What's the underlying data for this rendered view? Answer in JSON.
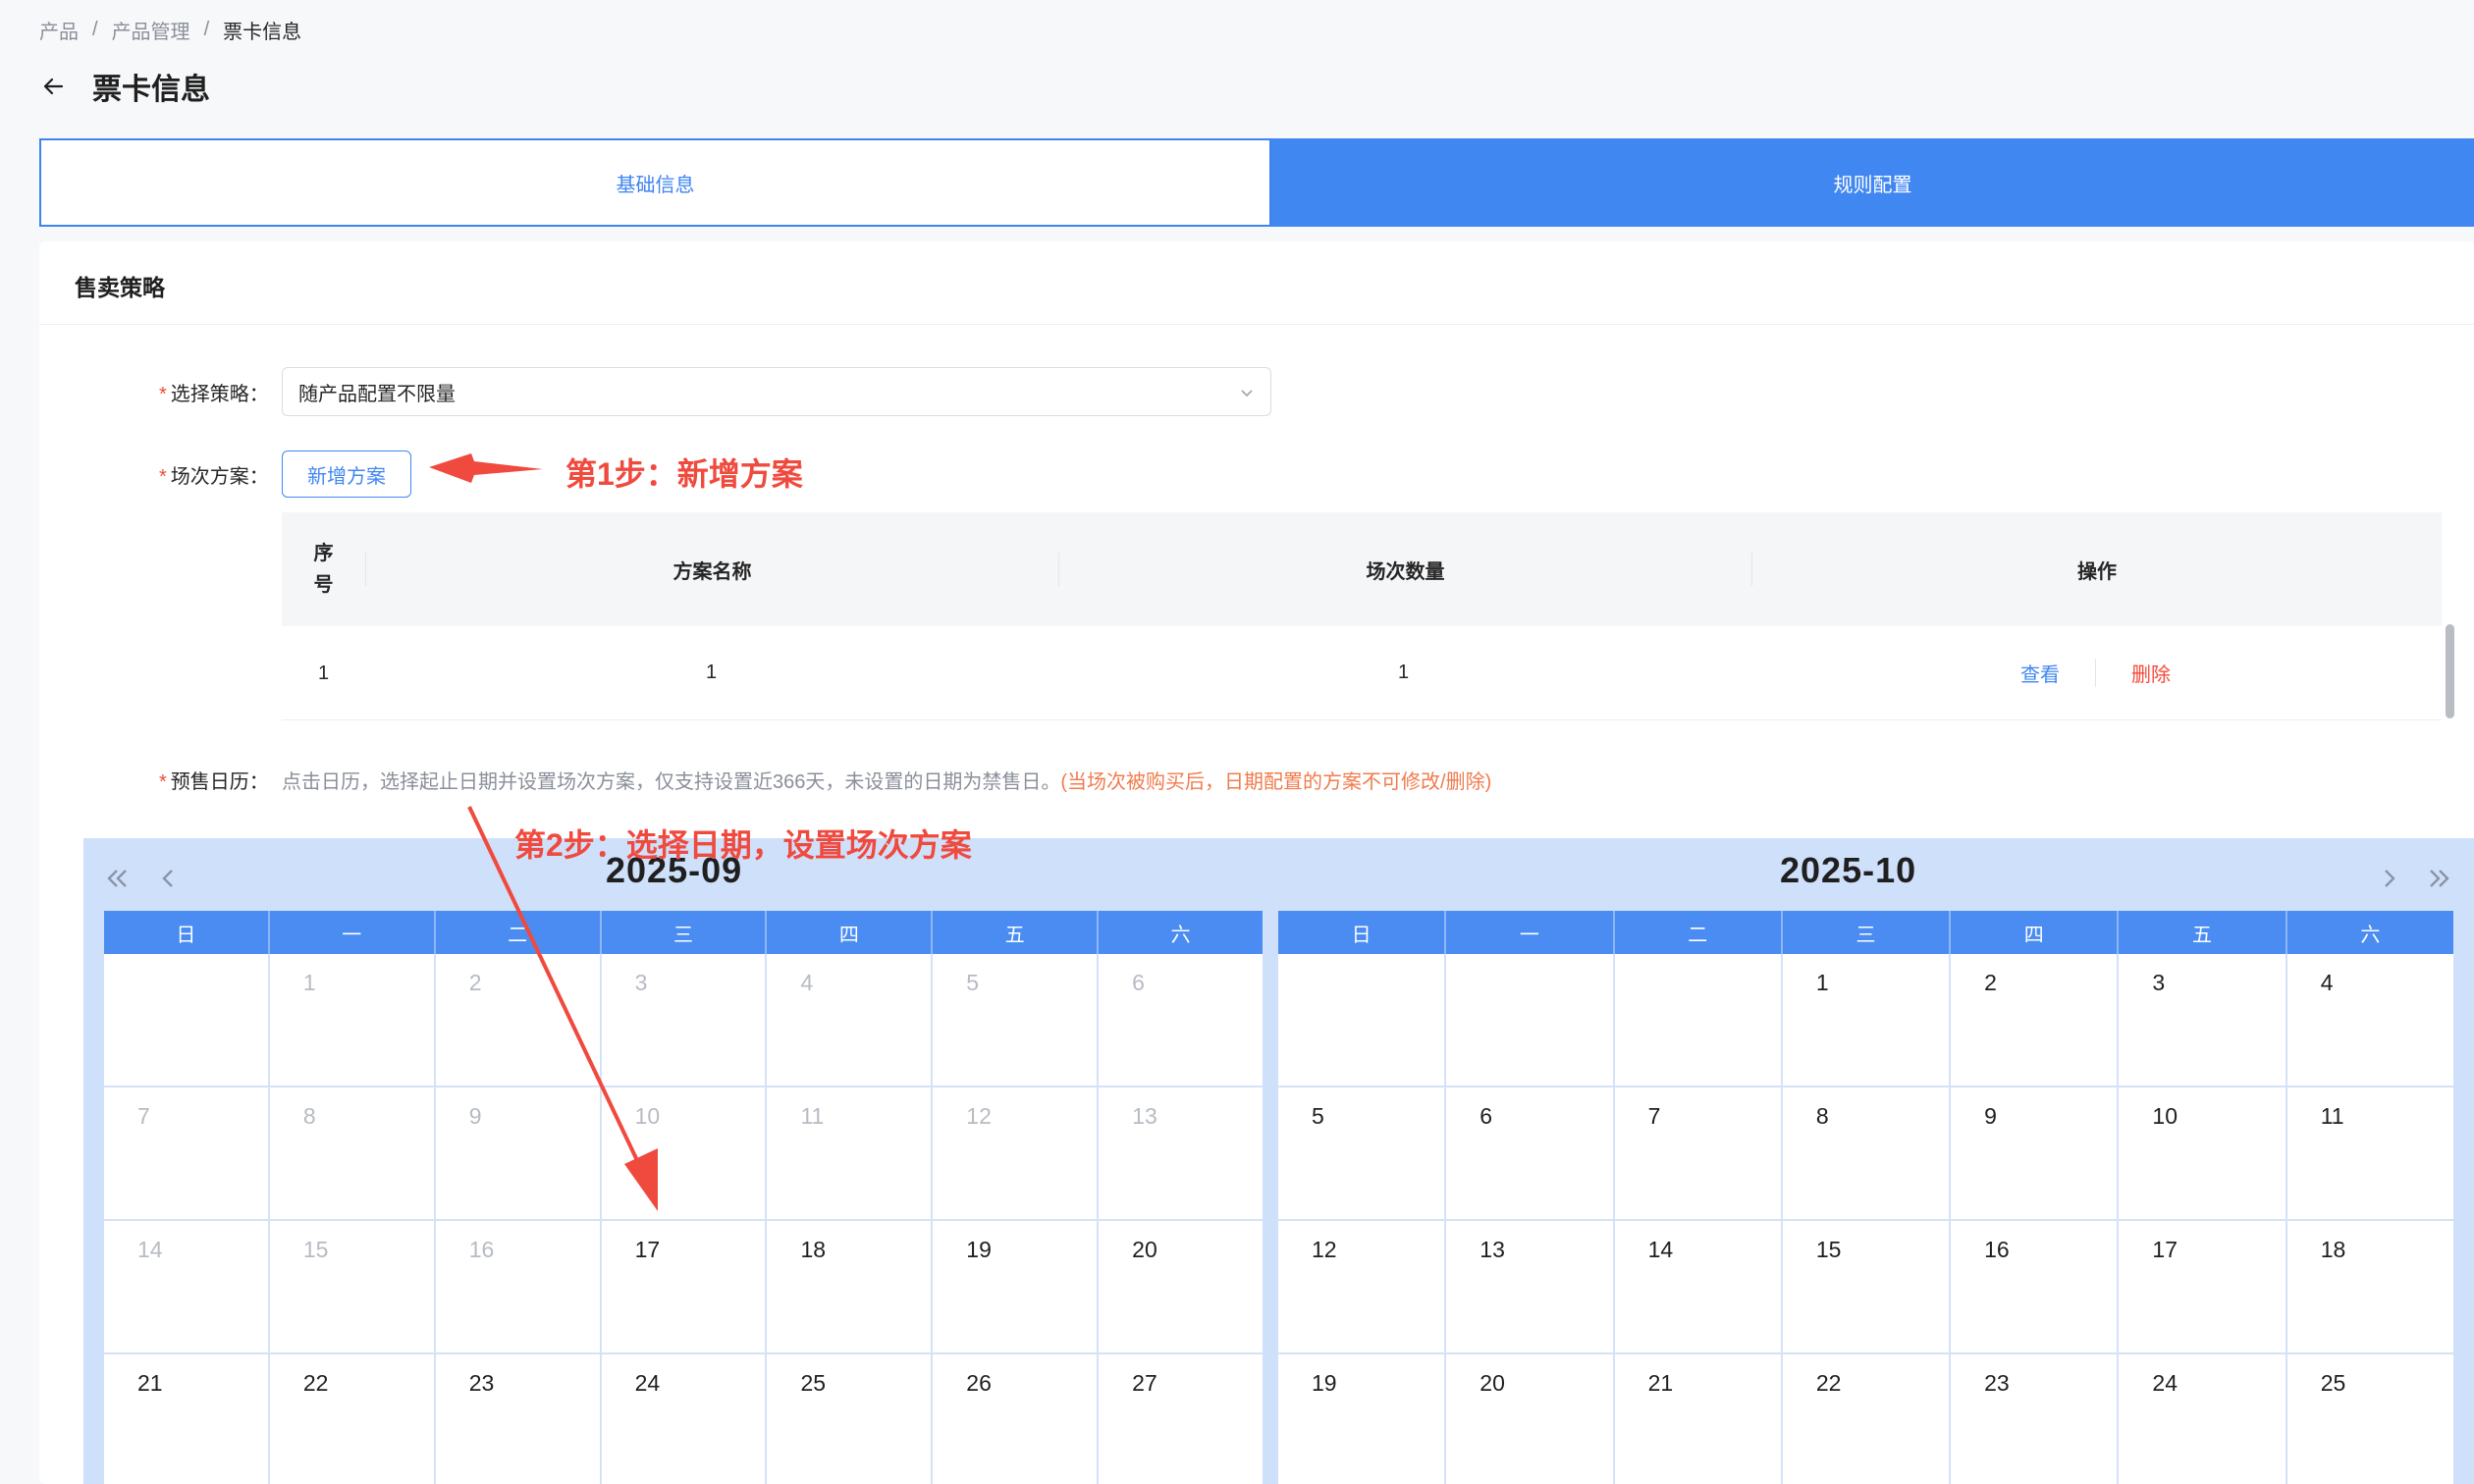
{
  "breadcrumb": {
    "items": [
      "产品",
      "产品管理",
      "票卡信息"
    ],
    "separator": "/"
  },
  "header": {
    "title": "票卡信息",
    "back_icon": "arrow-left-icon"
  },
  "tabs": [
    {
      "label": "基础信息",
      "active": false
    },
    {
      "label": "规则配置",
      "active": true
    }
  ],
  "section": {
    "title": "售卖策略"
  },
  "form": {
    "strategy": {
      "label": "选择策略：",
      "value": "随产品配置不限量"
    },
    "plan": {
      "label": "场次方案：",
      "add_button": "新增方案"
    },
    "calendar": {
      "label": "预售日历：",
      "hint": "点击日历，选择起止日期并设置场次方案，仅支持设置近366天，未设置的日期为禁售日。",
      "warning": "(当场次被购买后，日期配置的方案不可修改/删除)"
    }
  },
  "annotations": {
    "step1": "第1步：新增方案",
    "step2": "第2步：选择日期，设置场次方案"
  },
  "table": {
    "headers": {
      "index": "序号",
      "name": "方案名称",
      "count": "场次数量",
      "operation": "操作"
    },
    "rows": [
      {
        "index": "1",
        "name": "1",
        "count": "1",
        "view": "查看",
        "delete": "删除"
      }
    ]
  },
  "calendar": {
    "weekdays": [
      "日",
      "一",
      "二",
      "三",
      "四",
      "五",
      "六"
    ],
    "months": [
      {
        "title": "2025-09",
        "weeks": [
          [
            "",
            "1",
            "2",
            "3",
            "4",
            "5",
            "6"
          ],
          [
            "7",
            "8",
            "9",
            "10",
            "11",
            "12",
            "13"
          ],
          [
            "14",
            "15",
            "16",
            "17",
            "18",
            "19",
            "20"
          ],
          [
            "21",
            "22",
            "23",
            "24",
            "25",
            "26",
            "27"
          ]
        ],
        "first_active_day": 17
      },
      {
        "title": "2025-10",
        "weeks": [
          [
            "",
            "",
            "",
            "1",
            "2",
            "3",
            "4"
          ],
          [
            "5",
            "6",
            "7",
            "8",
            "9",
            "10",
            "11"
          ],
          [
            "12",
            "13",
            "14",
            "15",
            "16",
            "17",
            "18"
          ],
          [
            "19",
            "20",
            "21",
            "22",
            "23",
            "24",
            "25"
          ]
        ],
        "first_active_day": 1
      }
    ]
  },
  "colors": {
    "primary": "#4187f2",
    "danger": "#f5483b",
    "annotation": "#f04a3e",
    "calendar_bg": "#cfe0fb"
  }
}
